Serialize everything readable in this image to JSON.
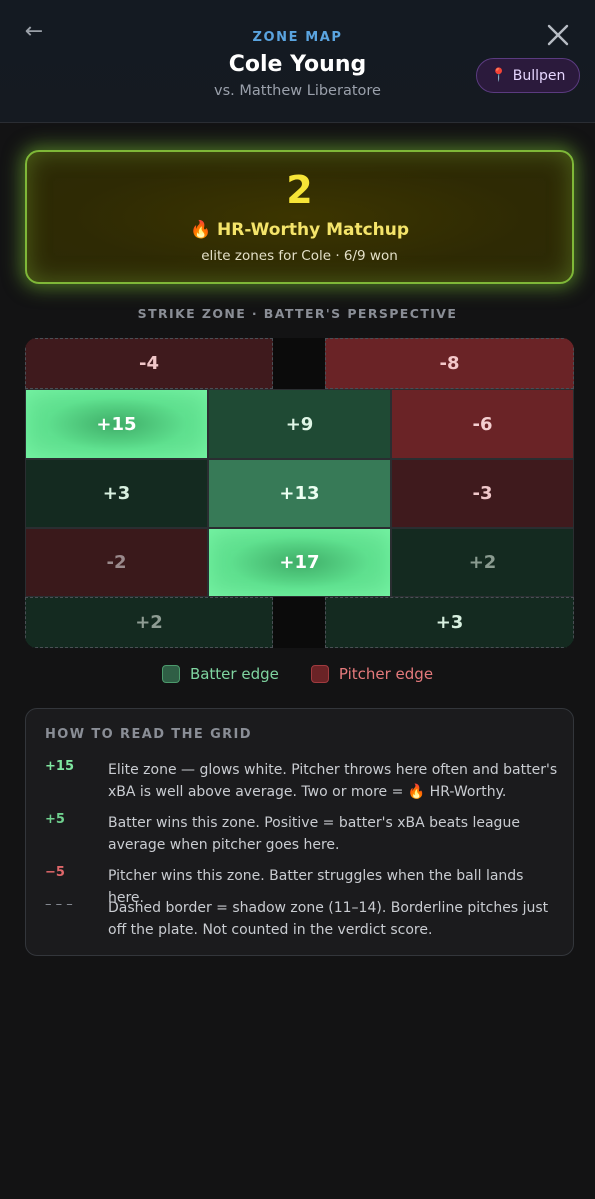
{
  "header": {
    "back_icon": "arrow-left-icon",
    "back_glyph": "←",
    "eyebrow": "ZONE MAP",
    "title": "Cole Young",
    "subtitle": "vs. Matthew Liberatore",
    "bullpen_label": "Bullpen",
    "bullpen_icon": "pin-icon",
    "bullpen_glyph": "📍",
    "close_icon": "close-icon"
  },
  "verdict": {
    "score": "2",
    "label": "🔥 HR-Worthy Matchup",
    "detail": "elite zones for Cole · 6/9 won"
  },
  "zone_heading": "STRIKE ZONE · BATTER'S PERSPECTIVE",
  "zones": {
    "shadow_top_left": "-4",
    "shadow_top_right": "-8",
    "r1c1": "+15",
    "r1c2": "+9",
    "r1c3": "-6",
    "r2c1": "+3",
    "r2c2": "+13",
    "r2c3": "-3",
    "r3c1": "-2",
    "r3c2": "+17",
    "r3c3": "+2",
    "shadow_bottom_left": "+2",
    "shadow_bottom_right": "+3"
  },
  "legend": {
    "batter": "Batter edge",
    "pitcher": "Pitcher edge"
  },
  "guide": {
    "title": "HOW TO READ THE GRID",
    "rows": [
      {
        "key": "+15",
        "text": "Elite zone — glows white. Pitcher throws here often and batter's xBA is well above average. Two or more = 🔥 HR-Worthy."
      },
      {
        "key": "+5",
        "text": "Batter wins this zone. Positive = batter's xBA beats league average when pitcher goes here."
      },
      {
        "key": "−5",
        "text": "Pitcher wins this zone. Batter struggles when the ball lands here."
      },
      {
        "key": "– – –",
        "text": "Dashed border = shadow zone (11–14). Borderline pitches just off the plate. Not counted in the verdict score."
      }
    ]
  },
  "colors": {
    "batter_edge": "#2f5e45",
    "pitcher_edge": "#6a2326",
    "elite_glow": "#5fe08f",
    "verdict_accent": "#f6e437",
    "eyebrow": "#5aa4e0"
  }
}
